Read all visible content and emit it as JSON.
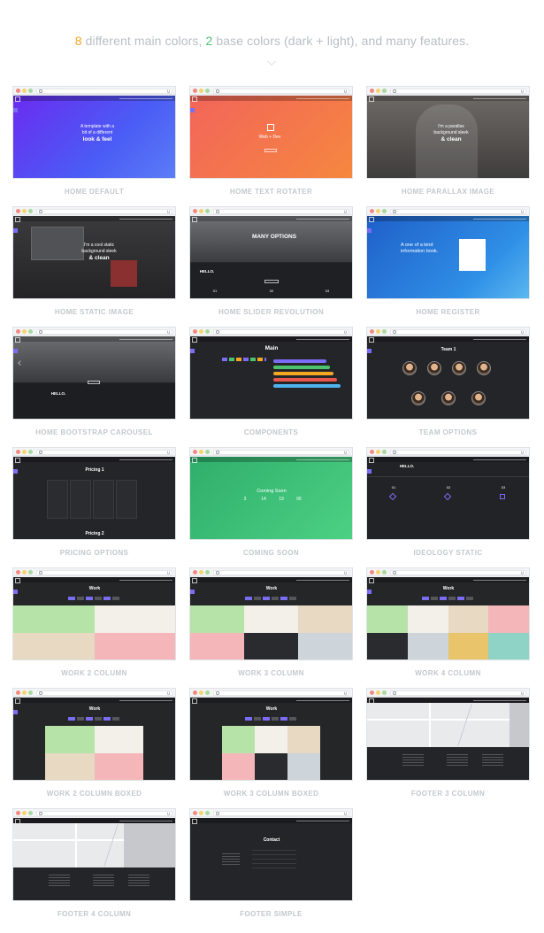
{
  "headline": {
    "n_colors": "8",
    "part1": " different main colors, ",
    "n_base": "2",
    "part2": " base colors (dark + light), and many features."
  },
  "accent_colors": {
    "orange": "#f5a623",
    "green": "#4cc26d",
    "purple": "#7b6cf6"
  },
  "cards": [
    {
      "label": "HOME DEFAULT",
      "screen_text": [
        "A template with a",
        "bit of a different",
        "look & feel"
      ]
    },
    {
      "label": "HOME TEXT ROTATER",
      "screen_text": [
        "Web + Dev"
      ]
    },
    {
      "label": "HOME PARALLAX IMAGE",
      "screen_text": [
        "I'm a parallax",
        "background sleek",
        "& clean"
      ]
    },
    {
      "label": "HOME STATIC IMAGE",
      "screen_text": [
        "I'm a cool static",
        "background sleek",
        "& clean"
      ]
    },
    {
      "label": "HOME SLIDER REVOLUTION",
      "screen_text": [
        "MANY OPTIONS",
        "HELLO.",
        "01",
        "02",
        "03"
      ]
    },
    {
      "label": "HOME REGISTER",
      "screen_text": [
        "A one of a kind",
        "information book."
      ]
    },
    {
      "label": "HOME BOOTSTRAP CAROUSEL",
      "screen_text": [
        "HELLO."
      ]
    },
    {
      "label": "COMPONENTS",
      "screen_text": [
        "Main"
      ]
    },
    {
      "label": "TEAM OPTIONS",
      "screen_text": [
        "Team 1"
      ]
    },
    {
      "label": "PRICING OPTIONS",
      "screen_text": [
        "Pricing 1",
        "Pricing 2"
      ]
    },
    {
      "label": "COMING SOON",
      "screen_text": [
        "Coming Soon",
        "3",
        "14",
        "19",
        "06"
      ]
    },
    {
      "label": "IDEOLOGY STATIC",
      "screen_text": [
        "HELLO.",
        "01",
        "02",
        "03"
      ]
    },
    {
      "label": "WORK 2 COLUMN",
      "screen_text": [
        "Work"
      ]
    },
    {
      "label": "WORK 3 COLUMN",
      "screen_text": [
        "Work"
      ]
    },
    {
      "label": "WORK 4 COLUMN",
      "screen_text": [
        "Work"
      ]
    },
    {
      "label": "WORK 2 COLUMN BOXED",
      "screen_text": [
        "Work"
      ]
    },
    {
      "label": "WORK 3 COLUMN BOXED",
      "screen_text": [
        "Work"
      ]
    },
    {
      "label": "FOOTER 3 COLUMN",
      "screen_text": []
    },
    {
      "label": "FOOTER 4 COLUMN",
      "screen_text": []
    },
    {
      "label": "FOOTER SIMPLE",
      "screen_text": [
        "Contact"
      ]
    }
  ]
}
